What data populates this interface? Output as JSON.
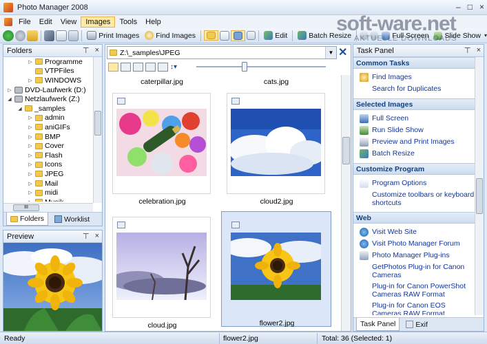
{
  "title": {
    "text": "Photo Manager 2008",
    "minimize": "–",
    "maximize": "□",
    "close": "×"
  },
  "menu": [
    "File",
    "Edit",
    "View",
    "Images",
    "Tools",
    "Help"
  ],
  "toolbar": {
    "print": "Print Images",
    "find": "Find Images",
    "edit": "Edit",
    "batch": "Batch Resize",
    "fullscreen": "Full Screen",
    "slideshow": "Slide Show"
  },
  "watermark": {
    "main": "soft-ware.net",
    "sub": "AKTUELLE DOWNLOADS"
  },
  "folders": {
    "title": "Folders",
    "items": [
      {
        "label": "Programme",
        "indent": 3,
        "type": "folder",
        "tw": "▷"
      },
      {
        "label": "VTPFiles",
        "indent": 3,
        "type": "folder",
        "tw": ""
      },
      {
        "label": "WINDOWS",
        "indent": 3,
        "type": "folder",
        "tw": "▷"
      },
      {
        "label": "DVD-Laufwerk (D:)",
        "indent": 1,
        "type": "drive",
        "tw": "▷"
      },
      {
        "label": "Netzlaufwerk (Z:)",
        "indent": 1,
        "type": "drive",
        "tw": "◢"
      },
      {
        "label": "_samples",
        "indent": 2,
        "type": "folder",
        "tw": "◢"
      },
      {
        "label": "admin",
        "indent": 3,
        "type": "folder",
        "tw": "▷"
      },
      {
        "label": "aniGIFs",
        "indent": 3,
        "type": "folder",
        "tw": "▷"
      },
      {
        "label": "BMP",
        "indent": 3,
        "type": "folder",
        "tw": "▷"
      },
      {
        "label": "Cover",
        "indent": 3,
        "type": "folder",
        "tw": "▷"
      },
      {
        "label": "Flash",
        "indent": 3,
        "type": "folder",
        "tw": "▷"
      },
      {
        "label": "Icons",
        "indent": 3,
        "type": "folder",
        "tw": "▷"
      },
      {
        "label": "JPEG",
        "indent": 3,
        "type": "folder",
        "tw": "▷"
      },
      {
        "label": "Mail",
        "indent": 3,
        "type": "folder",
        "tw": "▷"
      },
      {
        "label": "midi",
        "indent": 3,
        "type": "folder",
        "tw": "▷"
      },
      {
        "label": "Musik",
        "indent": 3,
        "type": "folder",
        "tw": "▷"
      }
    ],
    "hscroll": "III",
    "tab_folders": "Folders",
    "tab_worklist": "Worklist"
  },
  "preview": {
    "title": "Preview"
  },
  "pane_controls": {
    "pin": "⊤",
    "close": "×"
  },
  "path": {
    "value": "Z:\\_samples\\JPEG",
    "drop": "▼",
    "close": "✕"
  },
  "viewbar": {
    "sort": "↕▾"
  },
  "images": {
    "top_labels": [
      "caterpillar.jpg",
      "cats.jpg"
    ],
    "cards": [
      {
        "name": "celebration.jpg",
        "selected": false
      },
      {
        "name": "cloud2.jpg",
        "selected": false
      },
      {
        "name": "cloud.jpg",
        "selected": false
      },
      {
        "name": "flower2.jpg",
        "selected": true
      }
    ]
  },
  "taskpanel": {
    "title": "Task Panel",
    "sections": [
      {
        "heading": "Common Tasks",
        "items": [
          {
            "label": "Find Images",
            "icon": "find-icon"
          },
          {
            "label": "Search for Duplicates",
            "icon": "none"
          }
        ]
      },
      {
        "heading": "Selected Images",
        "items": [
          {
            "label": "Full Screen",
            "icon": "fullscreen-icon"
          },
          {
            "label": "Run Slide Show",
            "icon": "slideshow-icon"
          },
          {
            "label": "Preview and Print Images",
            "icon": "print-icon"
          },
          {
            "label": "Batch Resize",
            "icon": "resize-icon"
          }
        ]
      },
      {
        "heading": "Customize Program",
        "items": [
          {
            "label": "Program Options",
            "icon": "options-icon"
          },
          {
            "label": "Customize toolbars or keyboard shortcuts",
            "icon": "none"
          }
        ]
      },
      {
        "heading": "Web",
        "items": [
          {
            "label": "Visit Web Site",
            "icon": "globe-icon"
          },
          {
            "label": "Visit Photo Manager Forum",
            "icon": "globe-icon"
          },
          {
            "label": "Photo Manager Plug-ins",
            "icon": "plugin-icon"
          },
          {
            "label": "GetPhotos Plug-in for Canon Cameras",
            "icon": "none"
          },
          {
            "label": "Plug-in for Canon PowerShot Cameras RAW Format",
            "icon": "none"
          },
          {
            "label": "Plug-in for Canon EOS Cameras RAW Format",
            "icon": "none"
          }
        ]
      }
    ],
    "tab_taskpanel": "Task Panel",
    "tab_exif": "Exif"
  },
  "status": {
    "ready": "Ready",
    "file": "flower2.jpg",
    "total": "Total: 36 (Selected: 1)"
  }
}
